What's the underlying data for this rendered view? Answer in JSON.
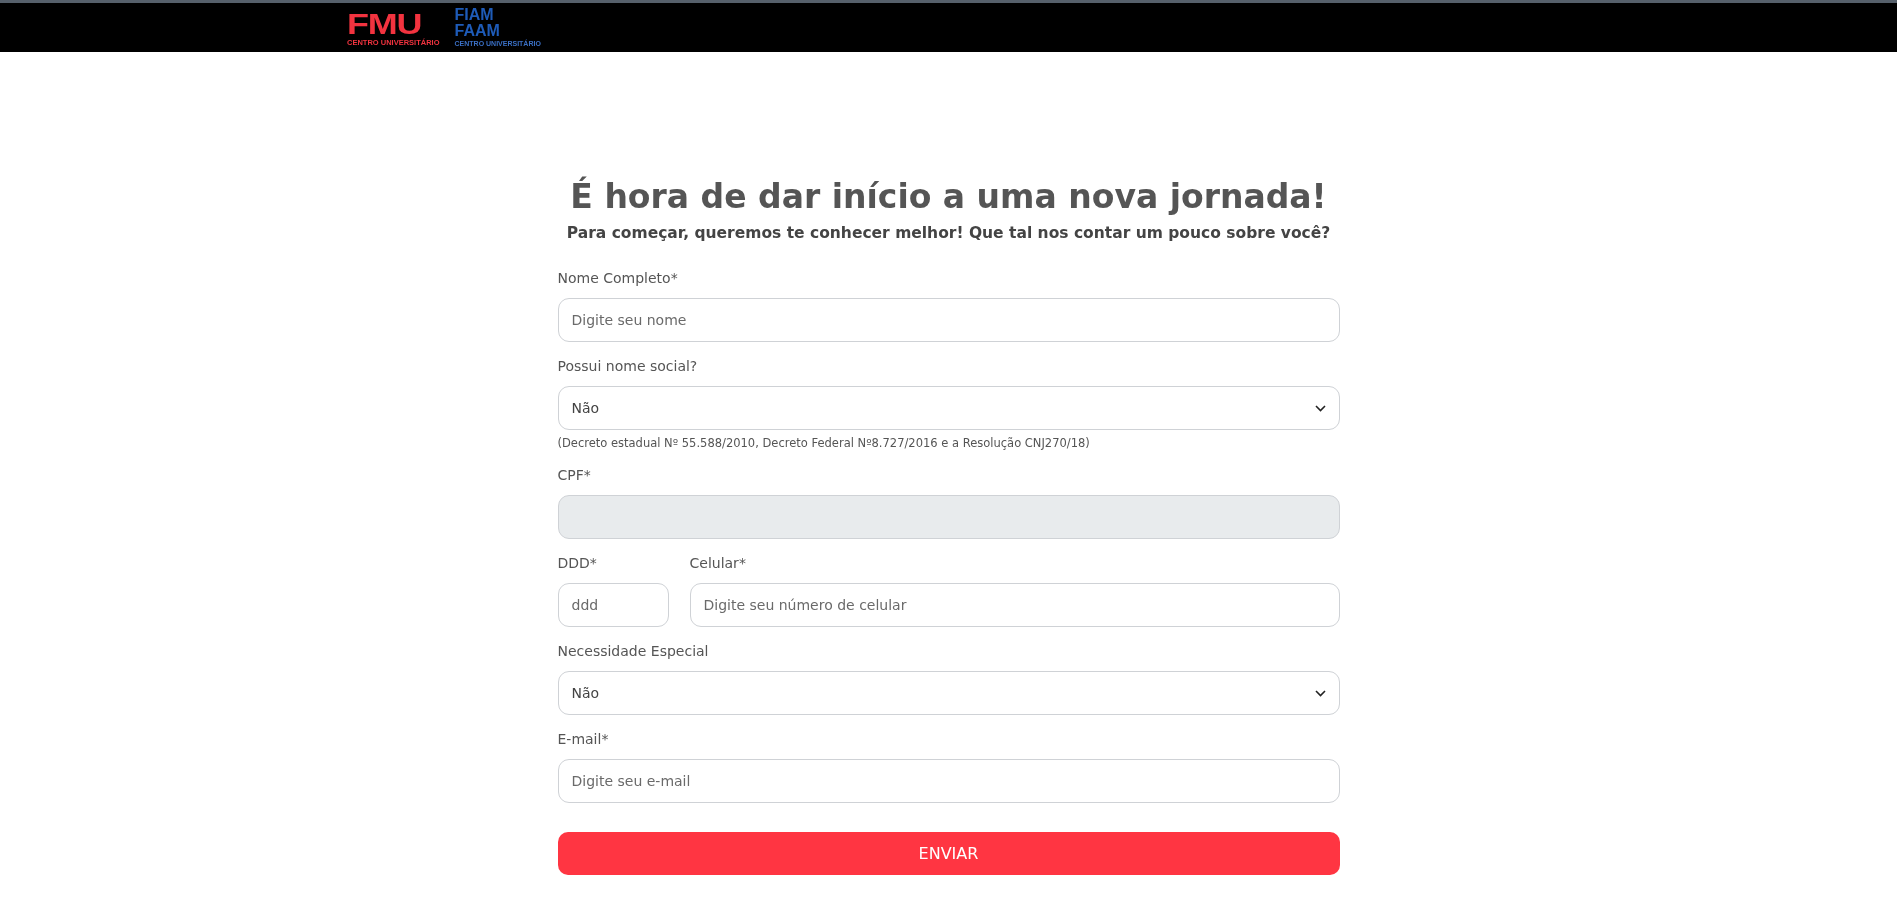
{
  "header": {
    "logos": [
      {
        "kind": "fmu",
        "name": "FMU",
        "tagline": "CENTRO UNIVERSITÁRIO"
      },
      {
        "kind": "fiam",
        "name": "FIAM",
        "name_2": "FAAM",
        "tagline": "CENTRO UNIVERSITÁRIO"
      }
    ]
  },
  "form": {
    "title": "É hora de dar início a uma nova jornada!",
    "subtitle": "Para começar, queremos te conhecer melhor! Que tal nos contar um pouco sobre você?",
    "fields": [
      {
        "kind": "text",
        "label": "Nome Completo*",
        "placeholder": "Digite seu nome",
        "disabled": false
      },
      {
        "kind": "select",
        "label": "Possui nome social?",
        "value": "Não",
        "note": "(Decreto estadual Nº 55.588/2010, Decreto Federal Nº8.727/2016 e a Resolução CNJ270/18)"
      },
      {
        "kind": "text",
        "label": "CPF*",
        "disabled": true
      },
      {
        "kind": "row",
        "children": [
          {
            "kind": "text",
            "label": "DDD*",
            "placeholder": "ddd",
            "disabled": false
          },
          {
            "kind": "text",
            "label": "Celular*",
            "placeholder": "Digite seu número de celular",
            "disabled": false
          }
        ]
      },
      {
        "kind": "select",
        "label": "Necessidade Especial",
        "value": "Não"
      },
      {
        "kind": "text",
        "label": "E-mail*",
        "placeholder": "Digite seu e-mail",
        "disabled": false
      }
    ],
    "submit": "ENVIAR"
  }
}
